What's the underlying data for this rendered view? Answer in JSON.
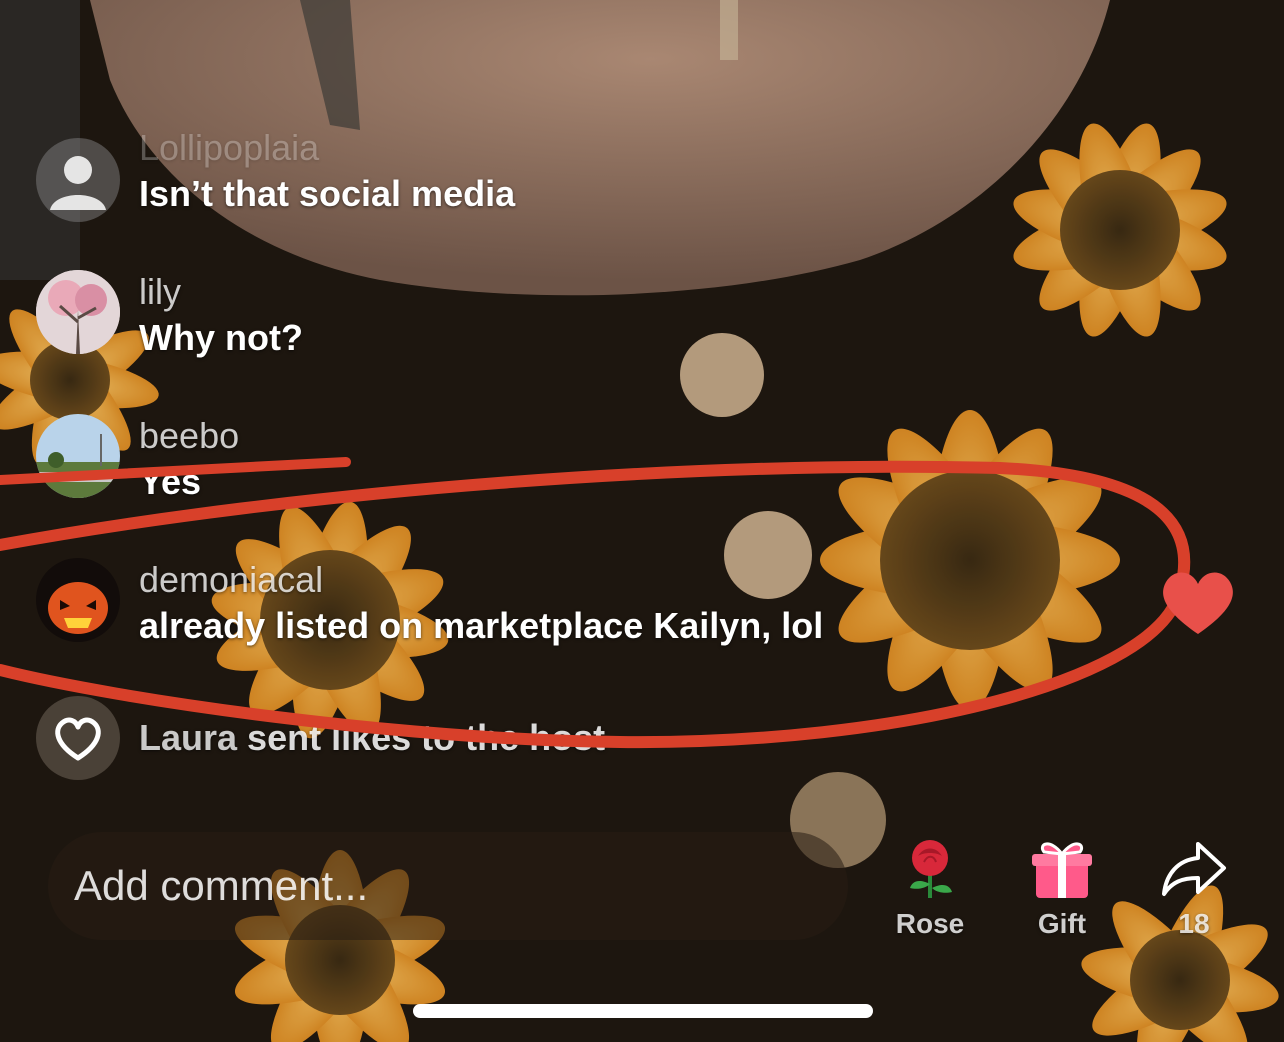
{
  "comments": [
    {
      "username": "Lollipoplaia",
      "message": "Isn’t that social media",
      "avatar": "default-avatar-icon"
    },
    {
      "username": "lily",
      "message": "Why not?",
      "avatar": "tree-photo"
    },
    {
      "username": "beebo",
      "message": "Yes",
      "avatar": "sky-photo"
    },
    {
      "username": "demoniacal",
      "message": "already listed on marketplace Kailyn, lol",
      "avatar": "pumpkin-photo"
    }
  ],
  "likes_notice": {
    "user": "Laura",
    "text": " sent likes to the host"
  },
  "input": {
    "placeholder": "Add comment..."
  },
  "actions": {
    "rose": {
      "label": "Rose",
      "icon": "rose-icon"
    },
    "gift": {
      "label": "Gift",
      "icon": "gift-icon"
    },
    "share": {
      "label": "18",
      "icon": "share-icon"
    }
  },
  "colors": {
    "annotation": "#d8402a",
    "heart": "#e8504a",
    "gift": "#ff5a8a"
  }
}
